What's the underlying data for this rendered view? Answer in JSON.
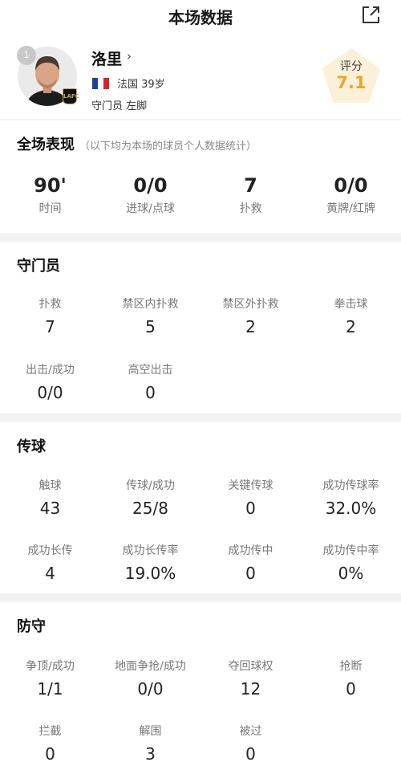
{
  "header": {
    "title": "本场数据"
  },
  "player": {
    "number": "1",
    "name": "洛里",
    "name_chevron": "›",
    "country_age": "法国  39岁",
    "position_foot": "守门员  左脚",
    "club_badge": "LAFC",
    "rating_label": "评分",
    "rating_value": "7.1"
  },
  "overall": {
    "title": "全场表现",
    "subtitle": "（以下均为本场的球员个人数据统计）",
    "stats": [
      {
        "value": "90'",
        "label": "时间"
      },
      {
        "value": "0/0",
        "label": "进球/点球"
      },
      {
        "value": "7",
        "label": "扑救"
      },
      {
        "value": "0/0",
        "label": "黄牌/红牌"
      }
    ]
  },
  "goalkeeper": {
    "title": "守门员",
    "stats": [
      {
        "label": "扑救",
        "value": "7"
      },
      {
        "label": "禁区内扑救",
        "value": "5"
      },
      {
        "label": "禁区外扑救",
        "value": "2"
      },
      {
        "label": "拳击球",
        "value": "2"
      },
      {
        "label": "出击/成功",
        "value": "0/0"
      },
      {
        "label": "高空出击",
        "value": "0"
      }
    ]
  },
  "passing": {
    "title": "传球",
    "stats": [
      {
        "label": "触球",
        "value": "43"
      },
      {
        "label": "传球/成功",
        "value": "25/8"
      },
      {
        "label": "关键传球",
        "value": "0"
      },
      {
        "label": "成功传球率",
        "value": "32.0%"
      },
      {
        "label": "成功长传",
        "value": "4"
      },
      {
        "label": "成功长传率",
        "value": "19.0%"
      },
      {
        "label": "成功传中",
        "value": "0"
      },
      {
        "label": "成功传中率",
        "value": "0%"
      }
    ]
  },
  "defense": {
    "title": "防守",
    "stats": [
      {
        "label": "争顶/成功",
        "value": "1/1"
      },
      {
        "label": "地面争抢/成功",
        "value": "0/0"
      },
      {
        "label": "夺回球权",
        "value": "12"
      },
      {
        "label": "抢断",
        "value": "0"
      },
      {
        "label": "拦截",
        "value": "0"
      },
      {
        "label": "解围",
        "value": "3"
      },
      {
        "label": "被过",
        "value": "0"
      }
    ]
  }
}
